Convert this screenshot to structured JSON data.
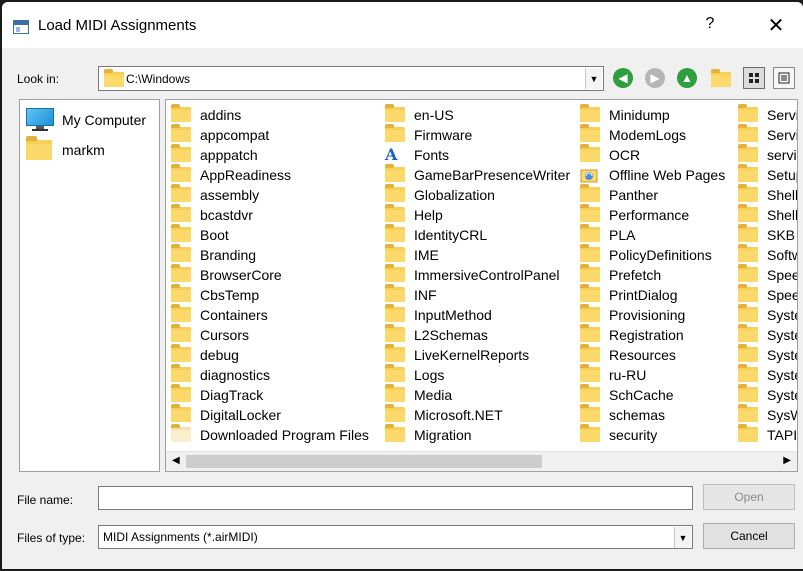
{
  "window": {
    "title": "Load MIDI Assignments",
    "help": "?",
    "close": "✕"
  },
  "look_in": {
    "label": "Look in:",
    "value": "C:\\Windows"
  },
  "sidebar": {
    "items": [
      {
        "label": "My Computer",
        "icon": "computer-icon"
      },
      {
        "label": "markm",
        "icon": "folder-icon"
      }
    ]
  },
  "files": {
    "columns": [
      [
        "addins",
        "appcompat",
        "apppatch",
        "AppReadiness",
        "assembly",
        "bcastdvr",
        "Boot",
        "Branding",
        "BrowserCore",
        "CbsTemp",
        "Containers",
        "Cursors",
        "debug",
        "diagnostics",
        "DiagTrack",
        "DigitalLocker",
        "Downloaded Program Files"
      ],
      [
        "en-US",
        "Firmware",
        "Fonts",
        "GameBarPresenceWriter",
        "Globalization",
        "Help",
        "IdentityCRL",
        "IME",
        "ImmersiveControlPanel",
        "INF",
        "InputMethod",
        "L2Schemas",
        "LiveKernelReports",
        "Logs",
        "Media",
        "Microsoft.NET",
        "Migration"
      ],
      [
        "Minidump",
        "ModemLogs",
        "OCR",
        "Offline Web Pages",
        "Panther",
        "Performance",
        "PLA",
        "PolicyDefinitions",
        "Prefetch",
        "PrintDialog",
        "Provisioning",
        "Registration",
        "Resources",
        "ru-RU",
        "SchCache",
        "schemas",
        "security"
      ],
      [
        "Servi",
        "Servi",
        "servic",
        "Setup",
        "Shell",
        "Shell",
        "SKB",
        "Softw",
        "Spee",
        "Spee",
        "Syste",
        "Syste",
        "Syste",
        "Syste",
        "Syste",
        "SysW",
        "TAPI"
      ]
    ],
    "special_icons": {
      "Fonts": "font-icon",
      "Offline Web Pages": "offline-pages-icon",
      "Downloaded Program Files": "special-folder-icon"
    }
  },
  "bottom": {
    "file_name_label": "File name:",
    "file_name_value": "",
    "file_type_label": "Files of type:",
    "file_type_value": "MIDI Assignments (*.airMIDI)",
    "open_button": "Open",
    "cancel_button": "Cancel"
  },
  "colors": {
    "folder": "#f8cf57",
    "nav_back": "#2e9e3e",
    "nav_forward_disabled": "#b5b5b5",
    "nav_up": "#2e9e3e"
  }
}
